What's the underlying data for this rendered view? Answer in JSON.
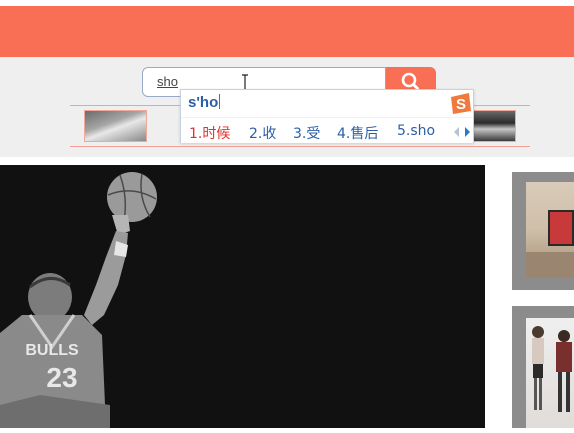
{
  "header": {
    "color": "#f86f55"
  },
  "search": {
    "value": "sho",
    "button_icon": "search-icon",
    "button_color": "#f86f55"
  },
  "ime": {
    "composition": "s'ho",
    "candidates": [
      {
        "label": "1.时候"
      },
      {
        "label": "2.收"
      },
      {
        "label": "3.受"
      },
      {
        "label": "4.售后"
      },
      {
        "label": "5.sho"
      }
    ],
    "logo_icon": "sogou-s-icon",
    "prev_icon": "triangle-left-icon",
    "next_icon": "triangle-right-icon"
  },
  "hero": {
    "description_icon": "basketball-player-image"
  }
}
